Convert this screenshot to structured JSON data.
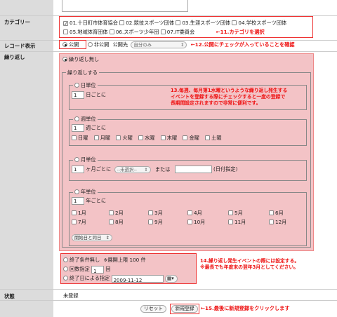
{
  "labels": {
    "category": "カテゴリー",
    "record": "レコード表示",
    "repeat": "繰り返し",
    "status": "状態"
  },
  "category": {
    "options": [
      {
        "label": "01.十日町市体育協会",
        "checked": true
      },
      {
        "label": "02.競技スポーツ団体",
        "checked": false
      },
      {
        "label": "03.生涯スポーツ団体",
        "checked": false
      },
      {
        "label": "04.学校スポーツ団体",
        "checked": false
      },
      {
        "label": "05.地域体育団体",
        "checked": false
      },
      {
        "label": "06.スポーツ少年団",
        "checked": false
      },
      {
        "label": "07.IT委員会",
        "checked": false
      }
    ],
    "annotation": "←11.カテゴリを選択"
  },
  "record": {
    "public": "公開",
    "private": "非公開",
    "public_dest": "公開先",
    "select_value": "自分のみ",
    "annotation": "←12.公開にチェックが入っていることを確認"
  },
  "repeat": {
    "none": "繰り返し無し",
    "do_repeat": "繰り返しする",
    "day_unit": "日単位",
    "day_value": "1",
    "day_suffix": "日ごとに",
    "annotation13": "13.毎週、毎月第1水曜というような繰り返し発生する\nイベントを登録する際にチェックすると一度の登録で\n長期間設定されますので非常に便利です。",
    "week_unit": "週単位",
    "week_value": "1",
    "week_suffix": "週ごとに",
    "weekdays": [
      "日曜",
      "月曜",
      "火曜",
      "水曜",
      "木曜",
      "金曜",
      "土曜"
    ],
    "month_unit": "月単位",
    "month_value": "1",
    "month_suffix": "ヶ月ごとに",
    "month_select": "--未選択--",
    "or_text": "または",
    "date_spec": "(日付指定)",
    "year_unit": "年単位",
    "year_value": "1",
    "year_suffix": "年ごとに",
    "months": [
      "1月",
      "2月",
      "3月",
      "4月",
      "5月",
      "6月",
      "7月",
      "8月",
      "9月",
      "10月",
      "11月",
      "12月"
    ],
    "start_select": "開始日と同日",
    "end_none": "終了条件無し",
    "end_none_note": "※展開上限 100 件",
    "end_count": "回数指定",
    "end_count_value": "1",
    "end_count_suffix": "回",
    "end_date": "終了日による指定",
    "end_date_value": "2009-11-12",
    "annotation14": "14.繰り返し発生イベントの際には設定する。\n※最長でも年度末の翌年3月としてください。"
  },
  "status": {
    "value": "未登録"
  },
  "buttons": {
    "reset": "リセット",
    "register": "新規登録",
    "annotation15": "←15.最後に新規登録をクリックします"
  }
}
